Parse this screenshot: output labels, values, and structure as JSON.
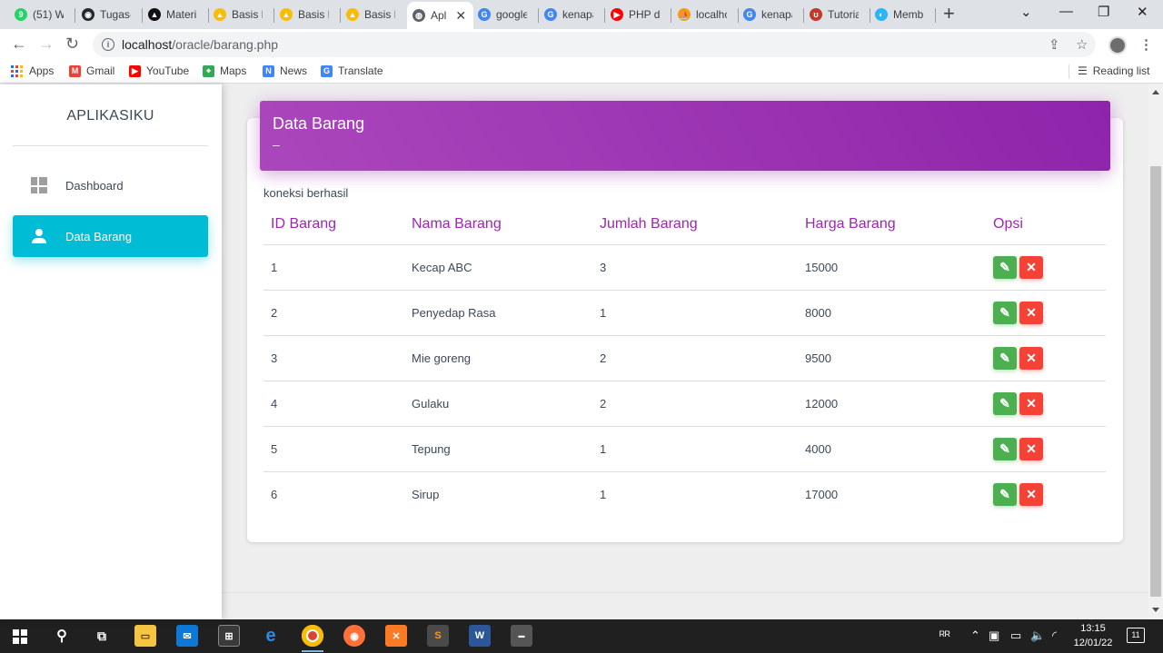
{
  "browser": {
    "tabs": [
      {
        "title": "(51) Wh",
        "icon": "whatsapp-icon",
        "color": "#25d366",
        "glyph": "9"
      },
      {
        "title": "Tugas-",
        "icon": "github-icon",
        "color": "#24292e",
        "glyph": "◉"
      },
      {
        "title": "Materi",
        "icon": "notion-icon",
        "color": "#111111",
        "glyph": "▲"
      },
      {
        "title": "Basis D",
        "icon": "google-drive-icon",
        "color": "#fbbc04",
        "glyph": "▲"
      },
      {
        "title": "Basis D",
        "icon": "google-drive-icon",
        "color": "#fbbc04",
        "glyph": "▲"
      },
      {
        "title": "Basis D",
        "icon": "google-drive-icon",
        "color": "#fbbc04",
        "glyph": "▲"
      },
      {
        "title": "Apl",
        "icon": "globe-icon",
        "color": "#5f6368",
        "glyph": "◍"
      },
      {
        "title": "google",
        "icon": "google-icon",
        "color": "#4285f4",
        "glyph": "G"
      },
      {
        "title": "kenapa",
        "icon": "google-icon",
        "color": "#4285f4",
        "glyph": "G"
      },
      {
        "title": "PHP da",
        "icon": "youtube-icon",
        "color": "#ff0000",
        "glyph": "▶"
      },
      {
        "title": "localhc",
        "icon": "phpmyadmin-icon",
        "color": "#f89c0e",
        "glyph": "⛵"
      },
      {
        "title": "kenapa",
        "icon": "google-icon",
        "color": "#4285f4",
        "glyph": "G"
      },
      {
        "title": "Tutoria",
        "icon": "tutorial-icon",
        "color": "#c0392b",
        "glyph": "ʊ"
      },
      {
        "title": "Memb",
        "icon": "browser-icon",
        "color": "#29b6f6",
        "glyph": "◐"
      }
    ],
    "active_tab_index": 6,
    "url_host": "localhost",
    "url_path": "/oracle/barang.php",
    "bookmarks": [
      {
        "label": "Apps",
        "icon": "apps-grid-icon"
      },
      {
        "label": "Gmail",
        "icon": "gmail-icon",
        "color": "#ea4335",
        "glyph": "M"
      },
      {
        "label": "YouTube",
        "icon": "youtube-icon",
        "color": "#ff0000",
        "glyph": "▶"
      },
      {
        "label": "Maps",
        "icon": "maps-icon",
        "color": "#34a853",
        "glyph": "⌖"
      },
      {
        "label": "News",
        "icon": "news-icon",
        "color": "#4285f4",
        "glyph": "N"
      },
      {
        "label": "Translate",
        "icon": "translate-icon",
        "color": "#4285f4",
        "glyph": "G"
      }
    ],
    "reading_list": "Reading list"
  },
  "sidebar": {
    "brand": "APLIKASIKU",
    "items": [
      {
        "label": "Dashboard",
        "icon": "dashboard-icon",
        "active": false
      },
      {
        "label": "Data Barang",
        "icon": "person-icon",
        "active": true
      }
    ]
  },
  "card": {
    "title": "Data Barang",
    "subtitle": "–",
    "status": "koneksi berhasil",
    "accent_color": "#9c27b0"
  },
  "table": {
    "headers": [
      "ID Barang",
      "Nama Barang",
      "Jumlah Barang",
      "Harga Barang",
      "Opsi"
    ],
    "rows": [
      {
        "id": "1",
        "nama": "Kecap ABC",
        "jumlah": "3",
        "harga": "15000"
      },
      {
        "id": "2",
        "nama": "Penyedap Rasa",
        "jumlah": "1",
        "harga": "8000"
      },
      {
        "id": "3",
        "nama": "Mie goreng",
        "jumlah": "2",
        "harga": "9500"
      },
      {
        "id": "4",
        "nama": "Gulaku",
        "jumlah": "2",
        "harga": "12000"
      },
      {
        "id": "5",
        "nama": "Tepung",
        "jumlah": "1",
        "harga": "4000"
      },
      {
        "id": "6",
        "nama": "Sirup",
        "jumlah": "1",
        "harga": "17000"
      }
    ],
    "edit_color": "#4caf50",
    "delete_color": "#f44336"
  },
  "taskbar": {
    "time": "13:15",
    "date": "12/01/22",
    "notification_count": "11"
  }
}
